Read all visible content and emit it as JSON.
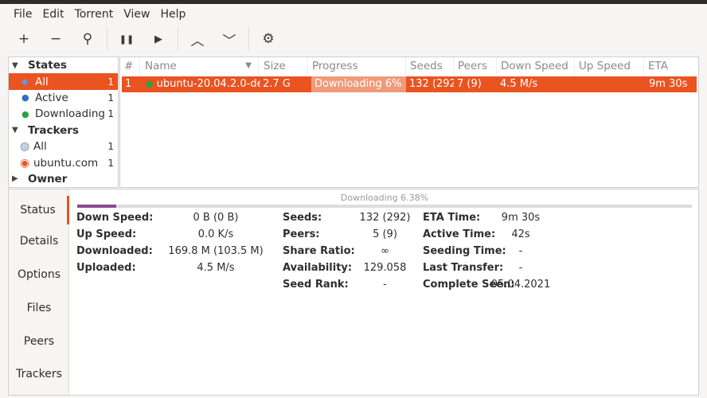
{
  "menu": [
    "File",
    "Edit",
    "Torrent",
    "View",
    "Help"
  ],
  "toolbar": {
    "add": "+",
    "remove": "−",
    "search": "⚲",
    "pause": "❚❚",
    "resume": "▶",
    "up": "︿",
    "down": "﹀",
    "prefs": "⚙"
  },
  "sidebar": {
    "states_label": "States",
    "states": [
      {
        "label": "All",
        "count": "1"
      },
      {
        "label": "Active",
        "count": "1"
      },
      {
        "label": "Downloading",
        "count": "1"
      }
    ],
    "trackers_label": "Trackers",
    "trackers": [
      {
        "label": "All",
        "count": "1"
      },
      {
        "label": "ubuntu.com",
        "count": "1"
      }
    ],
    "owner_label": "Owner"
  },
  "table": {
    "columns": [
      "#",
      "Name",
      "Size",
      "Progress",
      "Seeds",
      "Peers",
      "Down Speed",
      "Up Speed",
      "ETA"
    ],
    "rows": [
      {
        "num": "1",
        "name": "ubuntu-20.04.2.0-de",
        "size": "2.7 G",
        "progress": "Downloading 6%",
        "progress_value": 6,
        "seeds": "132 (292",
        "peers": "7 (9)",
        "down": "4.5 M/s",
        "up": "",
        "eta": "9m 30s"
      }
    ]
  },
  "details": {
    "tabs": [
      "Status",
      "Details",
      "Options",
      "Files",
      "Peers",
      "Trackers"
    ],
    "progress_text": "Downloading 6.38%",
    "progress_percent": 6.38,
    "col1": [
      {
        "label": "Down Speed:",
        "value": "0 B (0 B)"
      },
      {
        "label": "Up Speed:",
        "value": "0.0 K/s"
      },
      {
        "label": "Downloaded:",
        "value": "169.8 M (103.5 M)"
      },
      {
        "label": "Uploaded:",
        "value": "4.5 M/s"
      }
    ],
    "col2": [
      {
        "label": "Seeds:",
        "value": "132 (292)"
      },
      {
        "label": "Peers:",
        "value": "5 (9)"
      },
      {
        "label": "Share Ratio:",
        "value": "∞"
      },
      {
        "label": "Availability:",
        "value": "129.058"
      },
      {
        "label": "Seed Rank:",
        "value": "-"
      }
    ],
    "col3": [
      {
        "label": "ETA Time:",
        "value": "9m 30s"
      },
      {
        "label": "Active Time:",
        "value": "42s"
      },
      {
        "label": "Seeding Time:",
        "value": "-"
      },
      {
        "label": "Last Transfer:",
        "value": "-"
      },
      {
        "label": "Complete Seen:",
        "value": "05.04.2021"
      }
    ]
  },
  "colors": {
    "accent": "#e95420",
    "progress": "#8a4a8f"
  }
}
